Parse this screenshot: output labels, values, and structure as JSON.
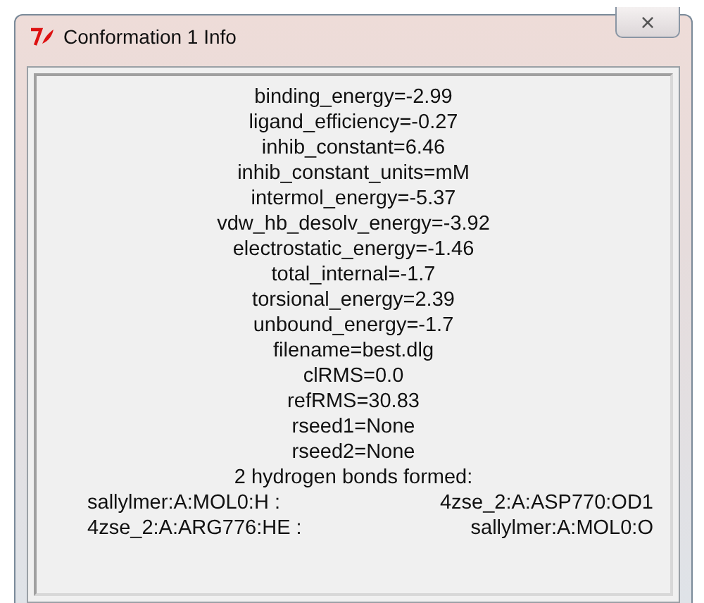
{
  "window": {
    "title": "Conformation 1 Info",
    "close": "×"
  },
  "info_lines": [
    "binding_energy=-2.99",
    "ligand_efficiency=-0.27",
    "inhib_constant=6.46",
    "inhib_constant_units=mM",
    "intermol_energy=-5.37",
    "vdw_hb_desolv_energy=-3.92",
    "electrostatic_energy=-1.46",
    "total_internal=-1.7",
    "torsional_energy=2.39",
    "unbound_energy=-1.7",
    "filename=best.dlg",
    "clRMS=0.0",
    "refRMS=30.83",
    "rseed1=None",
    "rseed2=None",
    "2 hydrogen bonds formed:"
  ],
  "hydrogen_bonds": [
    {
      "donor": "sallylmer:A:MOL0:H :",
      "acceptor": "4zse_2:A:ASP770:OD1"
    },
    {
      "donor": "4zse_2:A:ARG776:HE :",
      "acceptor": "sallylmer:A:MOL0:O"
    }
  ]
}
